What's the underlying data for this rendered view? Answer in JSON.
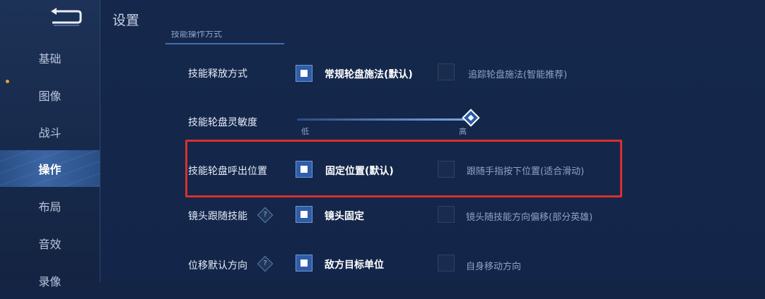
{
  "header": {
    "title": "设置"
  },
  "sidebar": {
    "back_icon": "back-arrow-icon",
    "items": [
      {
        "label": "基础"
      },
      {
        "label": "图像"
      },
      {
        "label": "战斗"
      },
      {
        "label": "操作",
        "active": true
      },
      {
        "label": "布局"
      },
      {
        "label": "音效"
      },
      {
        "label": "录像"
      }
    ]
  },
  "section": {
    "label": "技能操作方式"
  },
  "settings": [
    {
      "label": "技能释放方式",
      "option_on": "常规轮盘施法(默认)",
      "option_off": "追踪轮盘施法(智能推荐)",
      "selected": 0
    },
    {
      "label": "技能轮盘灵敏度",
      "min_label": "低",
      "max_label": "高",
      "value_fraction": 1.0
    },
    {
      "label": "技能轮盘呼出位置",
      "option_on": "固定位置(默认)",
      "option_off": "跟随手指按下位置(适合滑动)",
      "selected": 0
    },
    {
      "label": "镜头跟随技能",
      "option_on": "镜头固定",
      "option_off": "镜头随技能方向偏移(部分英雄)",
      "selected": 0,
      "help_icon": "?"
    },
    {
      "label": "位移默认方向",
      "option_on": "敌方目标单位",
      "option_off": "自身移动方向",
      "selected": 0,
      "help_icon": "?"
    }
  ],
  "colors": {
    "accent": "#2f5da8",
    "highlight_box": "#d9302c",
    "background": "#142445"
  }
}
